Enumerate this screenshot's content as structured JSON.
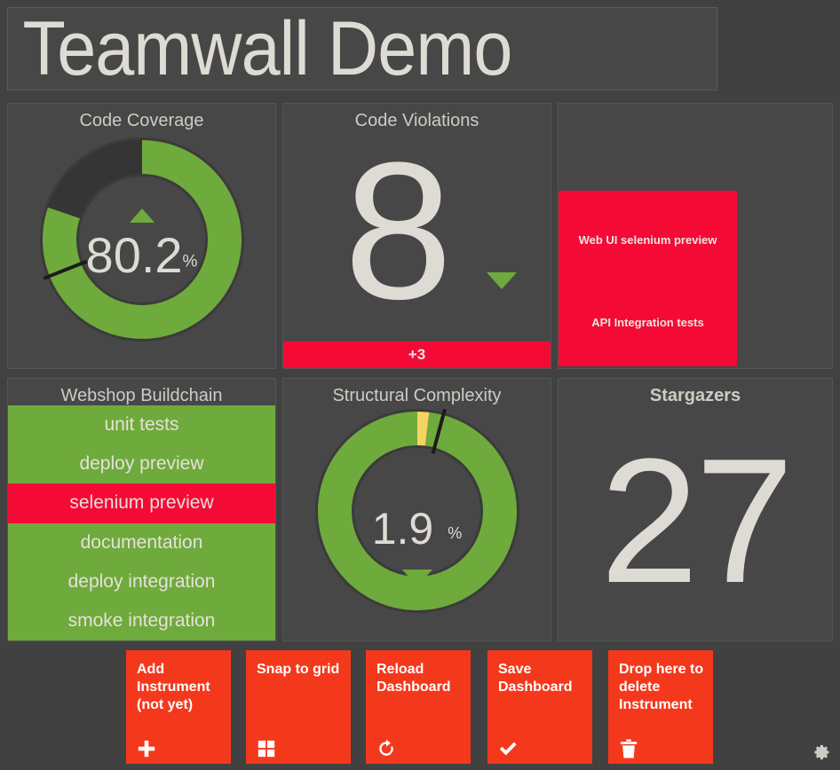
{
  "header": {
    "title": "Teamwall Demo"
  },
  "panels": {
    "code_coverage": {
      "title": "Code Coverage",
      "value": "80.2",
      "unit": "%",
      "trend": "up",
      "gauge": {
        "percent": 80.2,
        "threshold_percent": 69,
        "fill_color": "#6faa3c",
        "track_color": "#353535",
        "tick_color": "#1c1c1c"
      }
    },
    "code_violations": {
      "title": "Code Violations",
      "value": "8",
      "trend": "down",
      "delta": "+3",
      "delta_color": "#f50a35"
    },
    "alerts": {
      "items": [
        "Web UI selenium preview",
        "API Integration tests"
      ],
      "background_color": "#f50a35"
    },
    "buildchain": {
      "title": "Webshop Buildchain",
      "items": [
        {
          "label": "unit tests",
          "status": "passed"
        },
        {
          "label": "deploy preview",
          "status": "passed"
        },
        {
          "label": "selenium preview",
          "status": "failed"
        },
        {
          "label": "documentation",
          "status": "passed"
        },
        {
          "label": "deploy integration",
          "status": "passed"
        },
        {
          "label": "smoke integration",
          "status": "passed"
        }
      ],
      "passed_color": "#6faa3c",
      "failed_color": "#f50a35"
    },
    "structural_complexity": {
      "title": "Structural Complexity",
      "value": "1.9",
      "unit": "%",
      "trend": "down",
      "gauge": {
        "percent": 98.1,
        "warning_percent": 1.9,
        "threshold_percent": 4.2,
        "fill_color": "#6faa3c",
        "warning_color": "#f6d365",
        "tick_color": "#1c1c1c"
      }
    },
    "stargazers": {
      "title": "Stargazers",
      "value": "27"
    }
  },
  "toolbar": {
    "buttons": [
      {
        "label": "Add Instrument (not yet)",
        "icon": "plus-icon"
      },
      {
        "label": "Snap to grid",
        "icon": "grid-icon"
      },
      {
        "label": "Reload Dashboard",
        "icon": "refresh-icon"
      },
      {
        "label": "Save Dashboard",
        "icon": "check-icon"
      },
      {
        "label": "Drop here to delete Instrument",
        "icon": "trash-icon"
      }
    ],
    "button_color": "#f4381c",
    "settings_icon": "gear-icon"
  }
}
